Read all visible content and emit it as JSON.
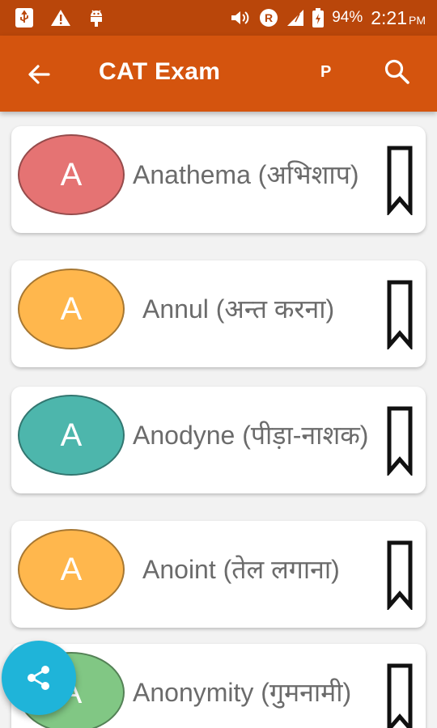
{
  "status_bar": {
    "battery": "94%",
    "time": "2:21",
    "ampm": "PM",
    "roaming": "R"
  },
  "app_bar": {
    "title": "CAT Exam",
    "p_label": "P"
  },
  "colors": {
    "status_bar": "#b9460a",
    "app_bar": "#d4540e",
    "fab": "#1fb4d9"
  },
  "words": [
    {
      "letter": "A",
      "text": "Anathema (अभिशाप)",
      "color": "#e57373"
    },
    {
      "letter": "A",
      "text": "Annul (अन्त करना)",
      "color": "#ffb74d"
    },
    {
      "letter": "A",
      "text": "Anodyne (पीड़ा-नाशक)",
      "color": "#4db6ac"
    },
    {
      "letter": "A",
      "text": "Anoint (तेल लगाना)",
      "color": "#ffb74d"
    },
    {
      "letter": "A",
      "text": "Anonymity (गुमनामी)",
      "color": "#81c784"
    }
  ]
}
